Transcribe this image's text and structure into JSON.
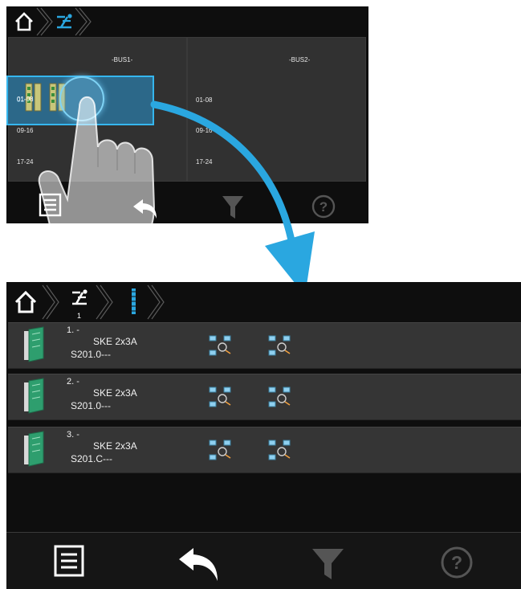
{
  "top_screen": {
    "bus_panels": [
      {
        "title": "-BUS1-",
        "slots": [
          "01-08",
          "09-16",
          "17-24"
        ]
      },
      {
        "title": "-BUS2-",
        "slots": [
          "01-08",
          "09-16",
          "17-24"
        ]
      }
    ],
    "footer_icons": [
      "menu-icon",
      "back-icon",
      "filter-icon",
      "help-icon"
    ]
  },
  "bottom_screen": {
    "breadcrumb": {
      "items": [
        "home-icon",
        "bus-icon",
        "module-icon"
      ],
      "bus_index": "1"
    },
    "modules": [
      {
        "number": "1. -",
        "type": "SKE 2x3A",
        "code": "S201.0---"
      },
      {
        "number": "2. -",
        "type": "SKE 2x3A",
        "code": "S201.0---"
      },
      {
        "number": "3. -",
        "type": "SKE 2x3A",
        "code": "S201.C---"
      }
    ],
    "footer_icons": [
      "menu-icon",
      "back-icon",
      "filter-icon",
      "help-icon"
    ]
  },
  "colors": {
    "accent": "#2aa7e0",
    "panel": "#353535",
    "background": "#0e0e0e",
    "disabled_icon": "#555555"
  }
}
